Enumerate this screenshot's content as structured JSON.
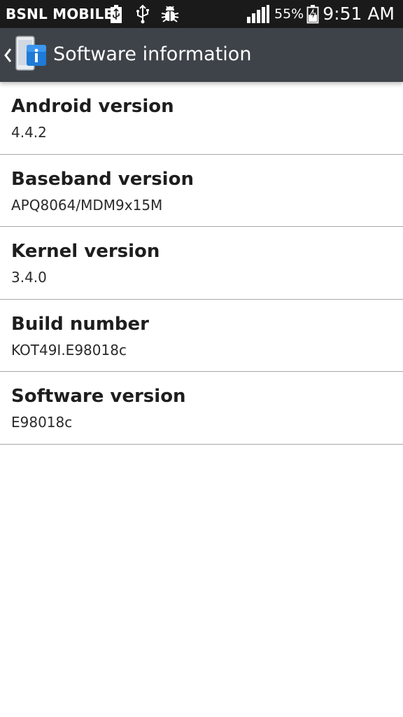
{
  "status_bar": {
    "carrier": "BSNL MOBILE",
    "battery_percent": "55%",
    "time": "9:51 AM",
    "icons": [
      "battery-charging-icon",
      "usb-icon",
      "debug-icon",
      "signal-icon",
      "battery-icon"
    ]
  },
  "action_bar": {
    "title": "Software information",
    "icon": "software-info-icon"
  },
  "items": [
    {
      "title": "Android version",
      "value": "4.4.2"
    },
    {
      "title": "Baseband version",
      "value": "APQ8064/MDM9x15M"
    },
    {
      "title": "Kernel version",
      "value": "3.4.0"
    },
    {
      "title": "Build number",
      "value": "KOT49I.E98018c"
    },
    {
      "title": "Software version",
      "value": "E98018c"
    }
  ],
  "colors": {
    "status_bar": "#1a1a1a",
    "action_bar": "#3e4349",
    "accent": "#1e7bd7"
  }
}
